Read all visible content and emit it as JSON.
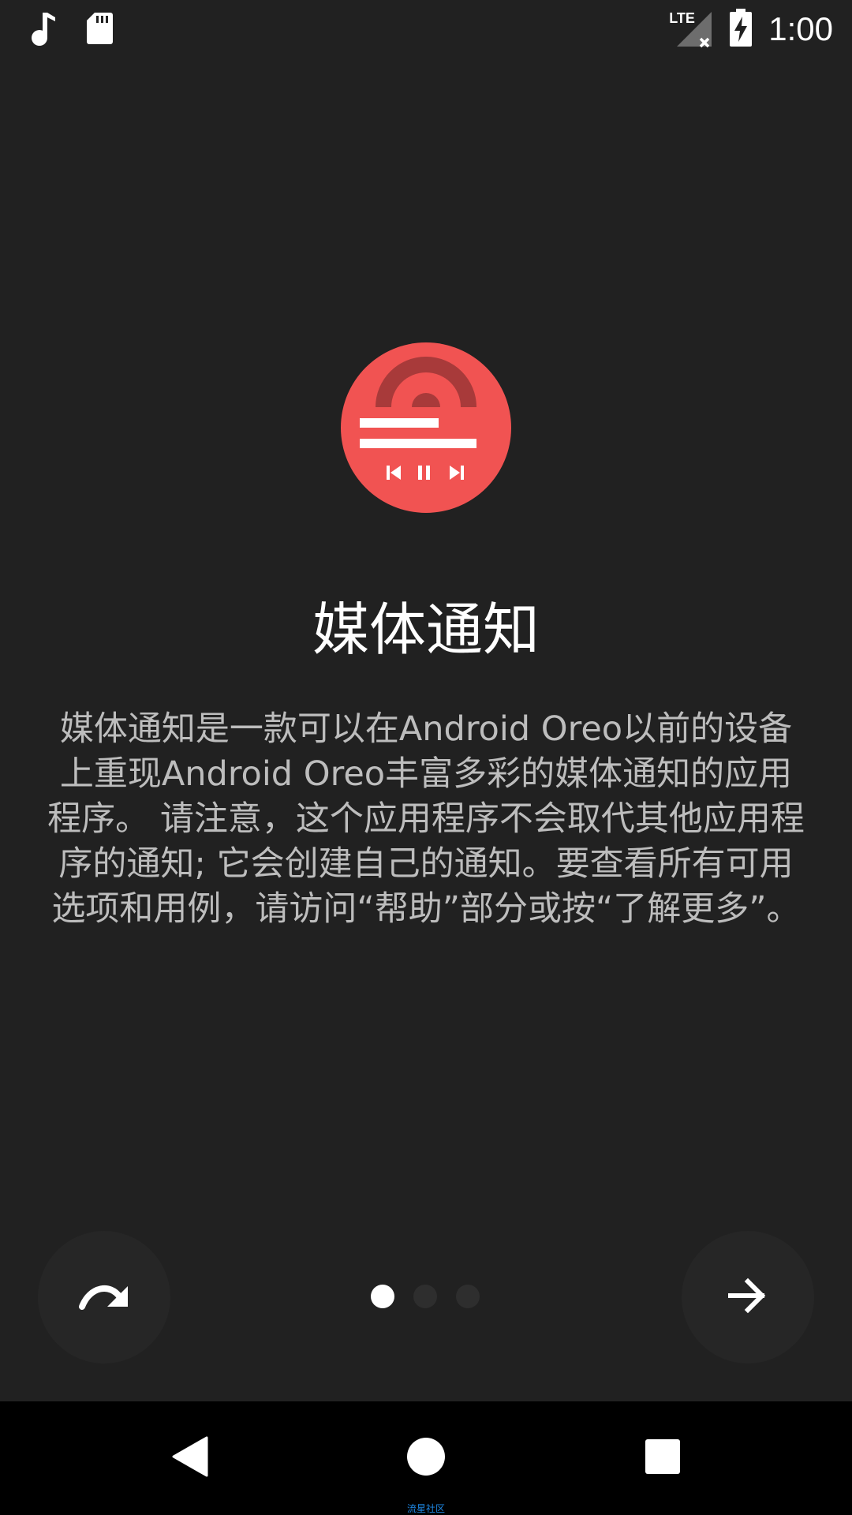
{
  "status_bar": {
    "time": "1:00",
    "network_label": "LTE",
    "icons": [
      "music-note-icon",
      "sd-card-icon",
      "lte-signal-icon",
      "battery-charging-icon"
    ]
  },
  "intro": {
    "title": "媒体通知",
    "description": "媒体通知是一款可以在Android Oreo以前的设备上重现Android Oreo丰富多彩的媒体通知的应用程序。 请注意，这个应用程序不会取代其他应用程序的通知; 它会创建自己的通知。要查看所有可用选项和用例，请访问“帮助”部分或按“了解更多”。"
  },
  "pager": {
    "page_count": 3,
    "current_page": 1
  },
  "colors": {
    "background": "#212121",
    "accent": "#f15352",
    "accent_dark": "#a83a3a",
    "text_secondary": "#bdbdbd"
  },
  "watermark": "流星社区"
}
